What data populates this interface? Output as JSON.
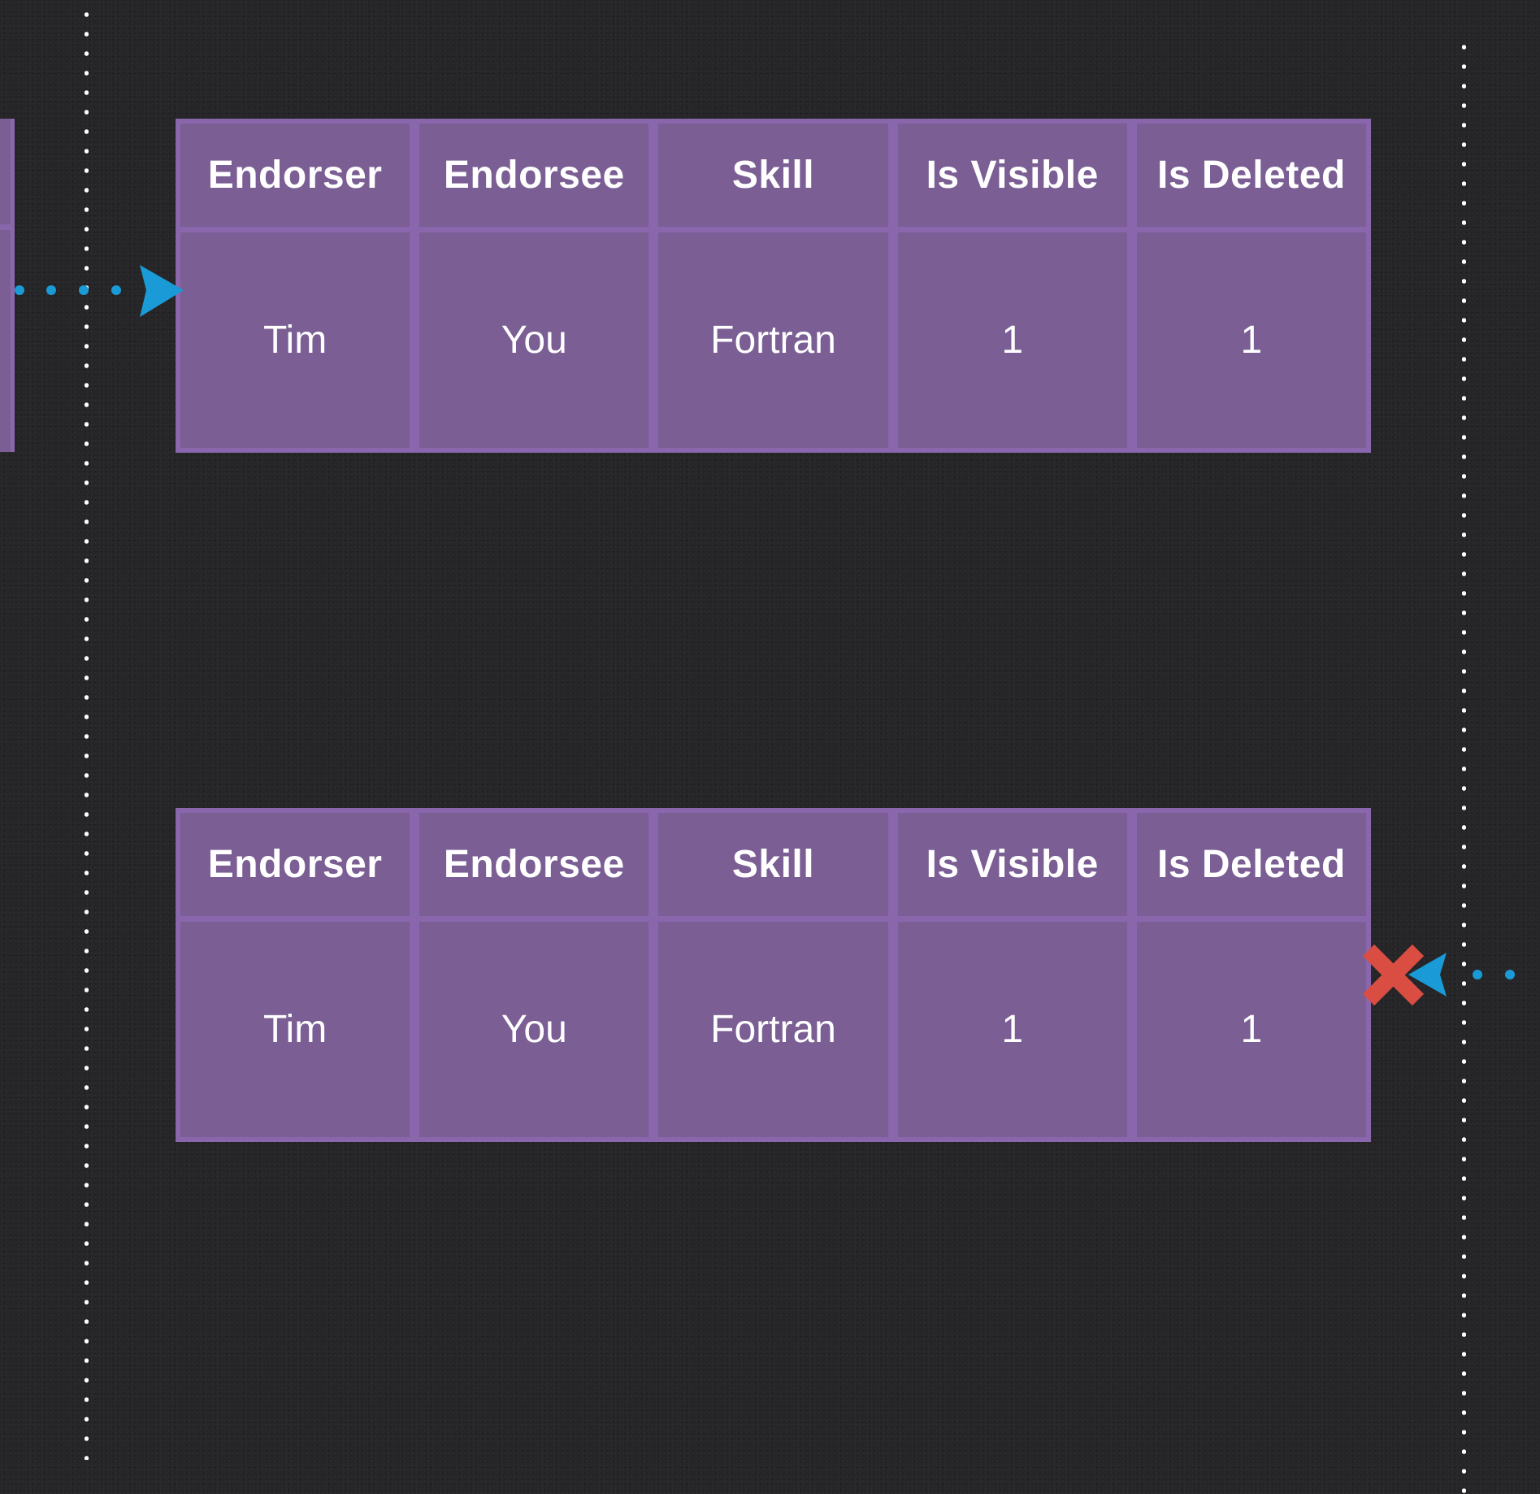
{
  "colors": {
    "background": "#262628",
    "table_fill": "#7a5e94",
    "table_border": "#8a66ad",
    "arrow": "#1a9ad6",
    "reject_mark": "#d94d42",
    "timeline": "#ffffff"
  },
  "tables": [
    {
      "columns": [
        "Endorser",
        "Endorsee",
        "Skill",
        "Is Visible",
        "Is Deleted"
      ],
      "row": [
        "Tim",
        "You",
        "Fortran",
        "1",
        "1"
      ]
    },
    {
      "columns": [
        "Endorser",
        "Endorsee",
        "Skill",
        "Is Visible",
        "Is Deleted"
      ],
      "row": [
        "Tim",
        "You",
        "Fortran",
        "1",
        "1"
      ]
    }
  ],
  "icons": {
    "incoming_arrow": "arrow-right-icon",
    "rejected_arrow": "arrow-left-icon",
    "reject_mark": "x-mark-icon"
  }
}
